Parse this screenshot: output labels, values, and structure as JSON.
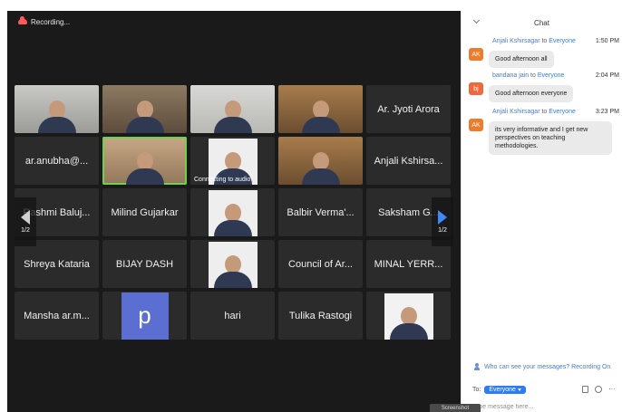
{
  "recording": {
    "label": "Recording..."
  },
  "gallery": {
    "page_indicator": "1/2",
    "tiles": [
      {
        "kind": "video",
        "style": "light"
      },
      {
        "kind": "video",
        "style": "warm"
      },
      {
        "kind": "video",
        "style": "grey"
      },
      {
        "kind": "video",
        "style": "room"
      },
      {
        "kind": "name",
        "label": "Ar. Jyoti Arora"
      },
      {
        "kind": "name",
        "label": "ar.anubha@..."
      },
      {
        "kind": "video",
        "style": "beige",
        "active": true
      },
      {
        "kind": "photo",
        "status": "Connecting to audio"
      },
      {
        "kind": "video",
        "style": "room"
      },
      {
        "kind": "name",
        "label": "Anjali Kshirsa..."
      },
      {
        "kind": "name",
        "label": "Rashmi Baluj..."
      },
      {
        "kind": "name",
        "label": "Milind Gujarkar"
      },
      {
        "kind": "photo"
      },
      {
        "kind": "name",
        "label": "Balbir Verma'..."
      },
      {
        "kind": "name",
        "label": "Saksham G..."
      },
      {
        "kind": "name",
        "label": "Shreya Kataria"
      },
      {
        "kind": "name",
        "label": "BIJAY DASH"
      },
      {
        "kind": "photo"
      },
      {
        "kind": "name",
        "label": "Council of Ar..."
      },
      {
        "kind": "name",
        "label": "MINAL YERR..."
      },
      {
        "kind": "name",
        "label": "Mansha ar.m..."
      },
      {
        "kind": "avatar",
        "letter": "p"
      },
      {
        "kind": "name",
        "label": "hari"
      },
      {
        "kind": "name",
        "label": "Tulika Rastogi"
      },
      {
        "kind": "photo",
        "bw": true
      }
    ]
  },
  "chat": {
    "title": "Chat",
    "messages": [
      {
        "sender": "Anjali Kshirsagar",
        "to": "to",
        "recipient": "Everyone",
        "time": "1:50 PM",
        "initials": "AK",
        "avatar_color": "#ee7d2b",
        "text": "Good afternoon all"
      },
      {
        "sender": "bandana jain",
        "to": "to",
        "recipient": "Everyone",
        "time": "2:04 PM",
        "initials": "bj",
        "avatar_color": "#ee6a3c",
        "text": "Good afternoon everyone"
      },
      {
        "sender": "Anjali Kshirsagar",
        "to": "to",
        "recipient": "Everyone",
        "time": "3:23 PM",
        "initials": "AK",
        "avatar_color": "#ee7d2b",
        "text": "its very informative and I get new perspectives on teaching methodologies."
      }
    ],
    "privacy_note": "Who can see your messages? Recording On",
    "to_label": "To:",
    "recipient_select": "Everyone",
    "input_placeholder": "Type message here..."
  },
  "screenshot_tag": "Screenshot"
}
